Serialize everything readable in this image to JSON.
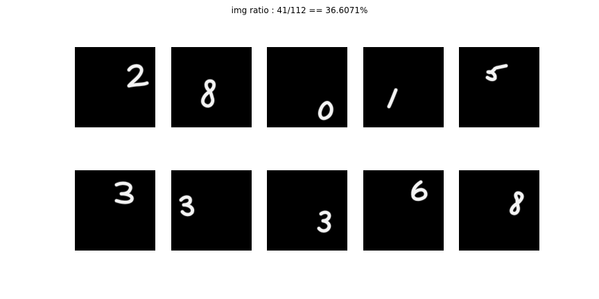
{
  "figure": {
    "title": "img ratio : 41/112 == 36.6071%"
  },
  "panels": [
    {
      "digit": "2"
    },
    {
      "digit": "8"
    },
    {
      "digit": "0"
    },
    {
      "digit": "1"
    },
    {
      "digit": "5"
    },
    {
      "digit": "3"
    },
    {
      "digit": "3"
    },
    {
      "digit": "3"
    },
    {
      "digit": "6"
    },
    {
      "digit": "8"
    }
  ]
}
